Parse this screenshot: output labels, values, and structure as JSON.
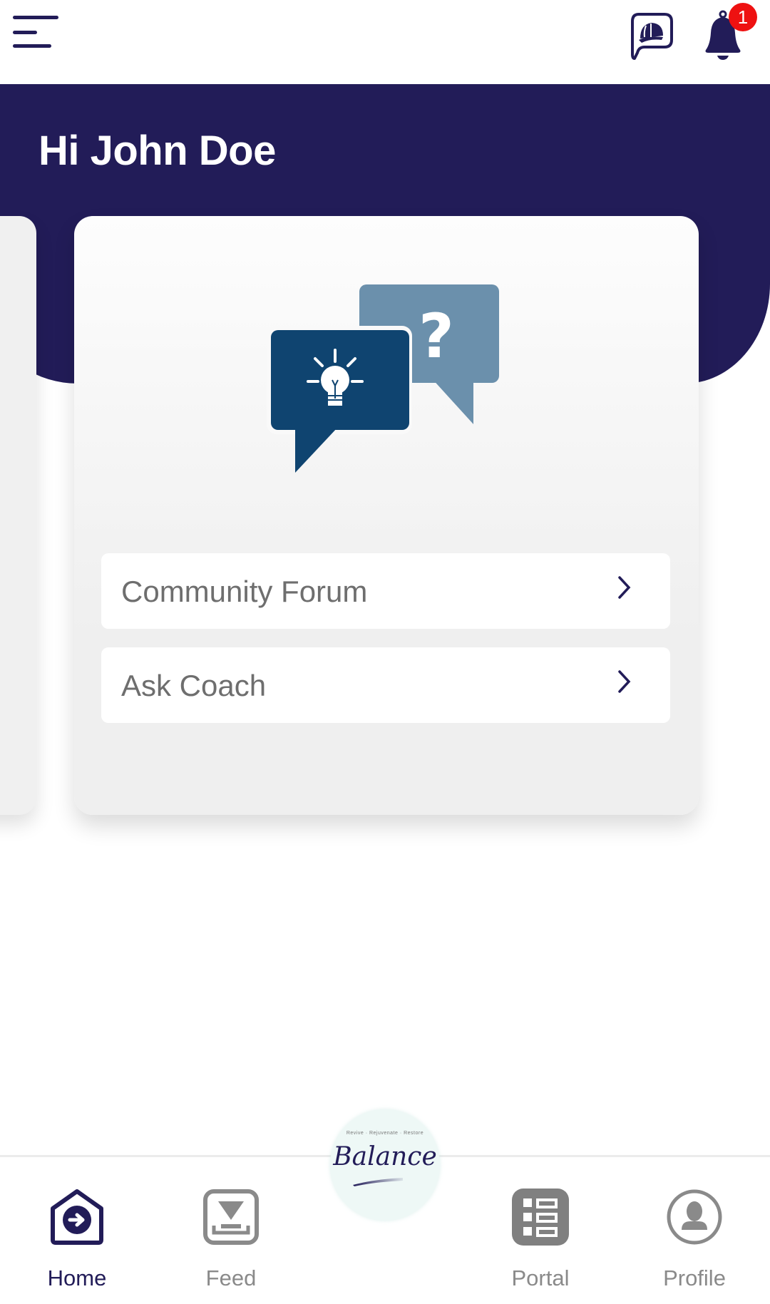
{
  "header": {
    "menu_icon": "hamburger-menu-icon",
    "coach_icon": "coach-cap-chat-icon",
    "notifications_icon": "bell-icon",
    "notification_count": "1",
    "greeting": "Hi John Doe"
  },
  "card": {
    "illustration": "idea-question-chat-bubbles",
    "items": [
      {
        "label": "Community Forum",
        "icon": "chevron-right-icon"
      },
      {
        "label": "Ask Coach",
        "icon": "chevron-right-icon"
      }
    ]
  },
  "bottom_nav": {
    "items": [
      {
        "label": "Home",
        "icon": "home-icon",
        "active": true
      },
      {
        "label": "Feed",
        "icon": "feed-icon",
        "active": false
      },
      {
        "label": "Portal",
        "icon": "portal-icon",
        "active": false
      },
      {
        "label": "Profile",
        "icon": "profile-icon",
        "active": false
      }
    ],
    "center_logo": {
      "tagline": "Revive · Rejuvenate · Restore",
      "wordmark": "Balance"
    }
  },
  "colors": {
    "brand": "#221C58",
    "badge": "#EE1111",
    "inactive": "#8A8A8A",
    "bubble_dark": "#0F4470",
    "bubble_light": "#6B90AC"
  }
}
